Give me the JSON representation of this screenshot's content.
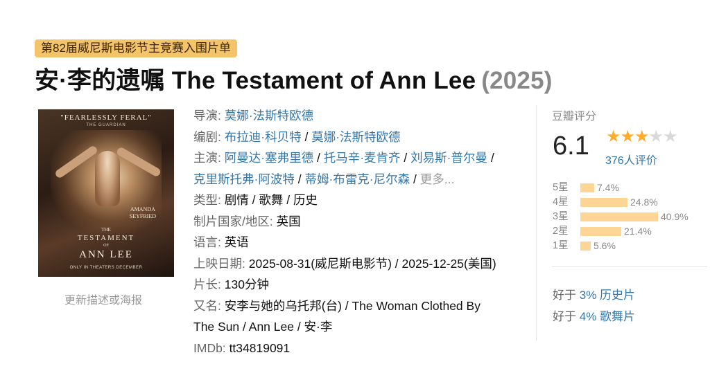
{
  "badge": "第82届威尼斯电影节主竞赛入围片单",
  "title": {
    "name": "安·李的遗嘱 The Testament of Ann Lee",
    "year": "(2025)"
  },
  "poster": {
    "quote": "\"FEARLESSLY FERAL\"",
    "quote_source": "THE GUARDIAN",
    "actor_first": "AMANDA",
    "actor_last": "SEYFRIED",
    "title_the": "THE",
    "title_testament": "TESTAMENT",
    "title_of": "OF",
    "title_annlee": "ANN LEE",
    "release": "ONLY IN THEATERS DECEMBER"
  },
  "update_link": "更新描述或海报",
  "info": {
    "director_label": "导演:",
    "director": "莫娜·法斯特欧德",
    "writer_label": "编剧:",
    "writers": [
      "布拉迪·科贝特",
      "莫娜·法斯特欧德"
    ],
    "cast_label": "主演:",
    "cast": [
      "阿曼达·塞弗里德",
      "托马辛·麦肯齐",
      "刘易斯·普尔曼",
      "克里斯托弗·阿波特",
      "蒂姆·布雷克·尼尔森"
    ],
    "cast_more": "更多...",
    "genre_label": "类型:",
    "genres": [
      "剧情",
      "歌舞",
      "历史"
    ],
    "country_label": "制片国家/地区:",
    "country": "英国",
    "language_label": "语言:",
    "language": "英语",
    "release_label": "上映日期:",
    "release": "2025-08-31(威尼斯电影节) / 2025-12-25(美国)",
    "runtime_label": "片长:",
    "runtime": "130分钟",
    "aka_label": "又名:",
    "aka_line1": "安李与她的乌托邦(台) / The Woman Clothed By",
    "aka_line2": "The Sun / Ann Lee / 安·李",
    "imdb_label": "IMDb:",
    "imdb": "tt34819091"
  },
  "rating": {
    "label": "豆瓣评分",
    "score": "6.1",
    "stars_filled": 3,
    "stars_total": 5,
    "votes": "376人评价",
    "distribution": [
      {
        "star": "5星",
        "percent": 7.4,
        "label": "7.4%"
      },
      {
        "star": "4星",
        "percent": 24.8,
        "label": "24.8%"
      },
      {
        "star": "3星",
        "percent": 40.9,
        "label": "40.9%"
      },
      {
        "star": "2星",
        "percent": 21.4,
        "label": "21.4%"
      },
      {
        "star": "1星",
        "percent": 5.6,
        "label": "5.6%"
      }
    ],
    "better_than": [
      {
        "prefix": "好于",
        "value": "3% 历史片"
      },
      {
        "prefix": "好于",
        "value": "4% 歌舞片"
      }
    ]
  },
  "colors": {
    "badge_bg": "#f4c46a",
    "link": "#3377aa",
    "star": "#ffac2d",
    "bar": "#ffd596"
  }
}
